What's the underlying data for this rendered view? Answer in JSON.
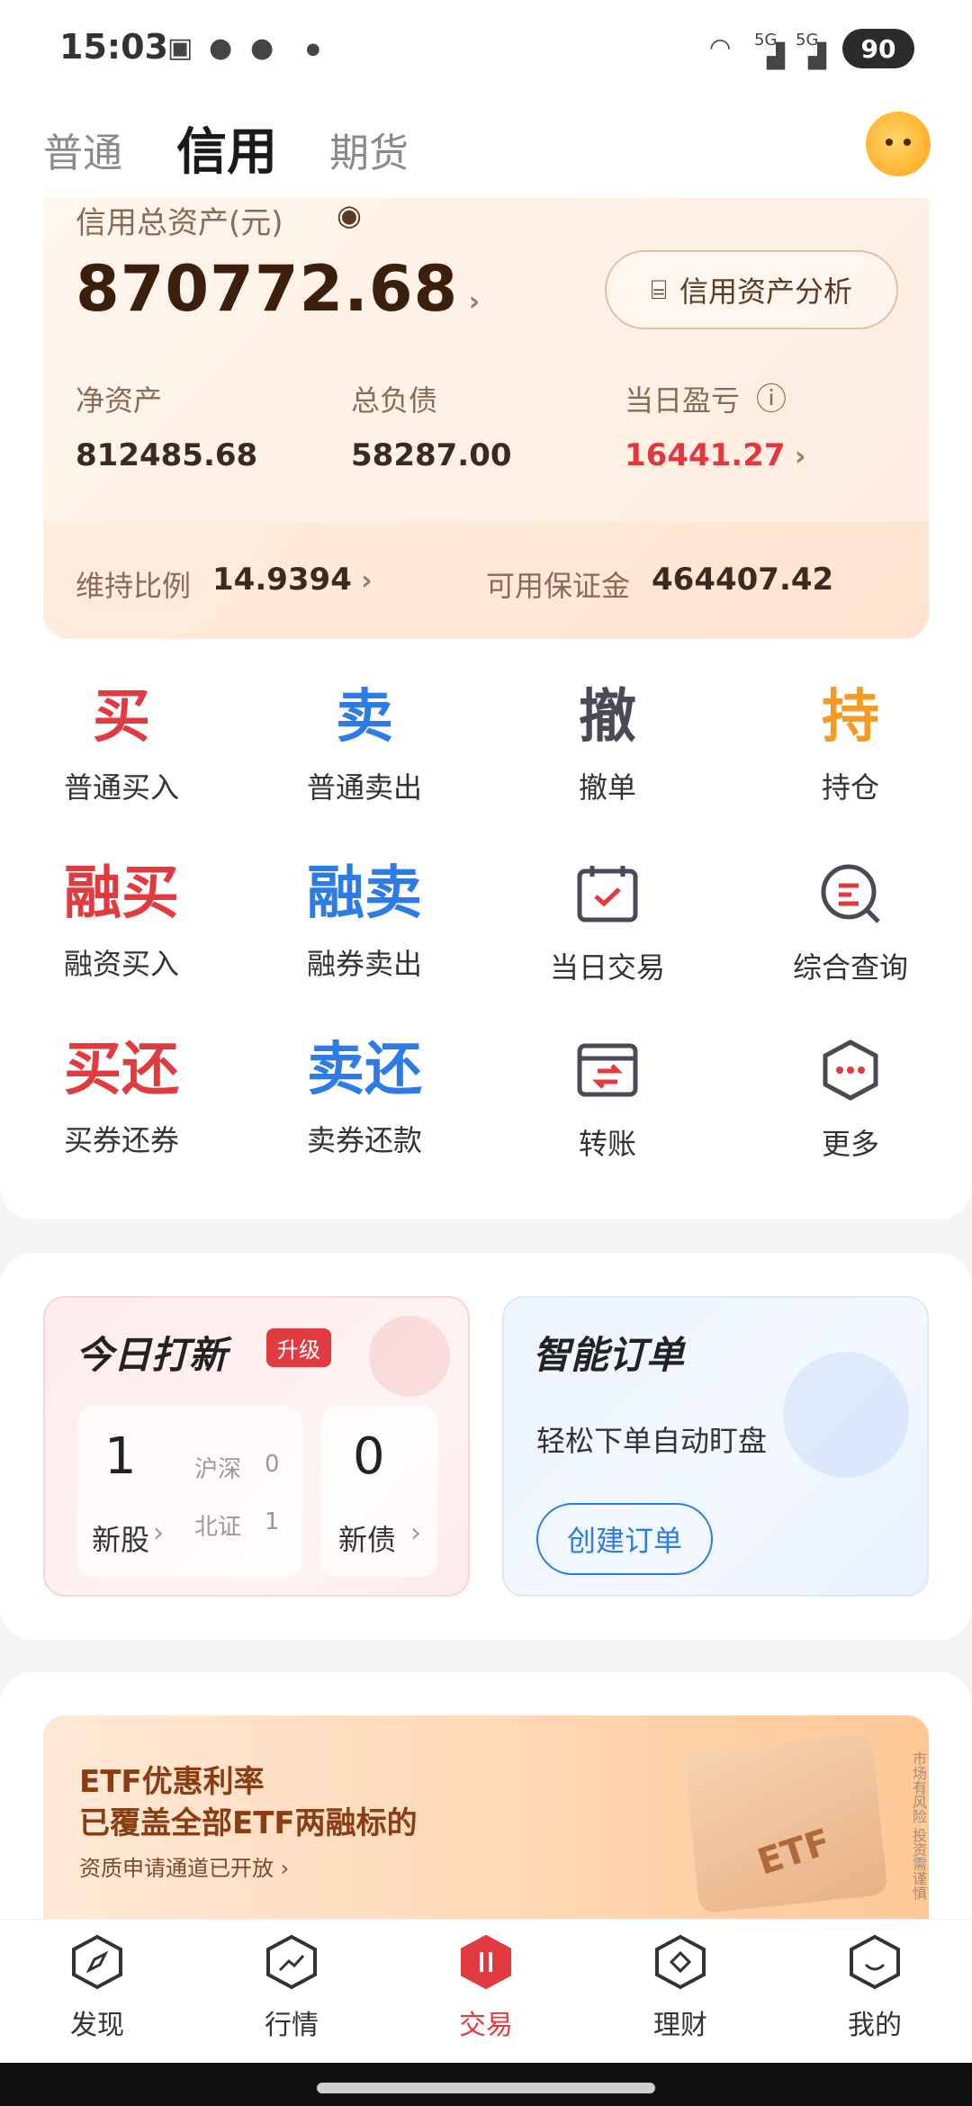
{
  "status_bar": {
    "time": "15:03",
    "signal1": "5G",
    "signal2": "5G",
    "battery": "90"
  },
  "tabs": [
    {
      "label": "普通",
      "active": false
    },
    {
      "label": "信用",
      "active": true
    },
    {
      "label": "期货",
      "active": false
    }
  ],
  "assets": {
    "total_label": "信用总资产(元)",
    "total_value": "870772.68",
    "analysis_button": "信用资产分析",
    "net_label": "净资产",
    "net_value": "812485.68",
    "debt_label": "总负债",
    "debt_value": "58287.00",
    "pnl_label": "当日盈亏",
    "pnl_value": "16441.27",
    "ratio_label": "维持比例",
    "ratio_value": "14.9394",
    "margin_label": "可用保证金",
    "margin_value": "464407.42"
  },
  "actions": [
    {
      "glyph": "买",
      "label": "普通买入",
      "color": "#e23b3f"
    },
    {
      "glyph": "卖",
      "label": "普通卖出",
      "color": "#2d7be6"
    },
    {
      "glyph": "撤",
      "label": "撤单",
      "color": "#4a4a56"
    },
    {
      "glyph": "持",
      "label": "持仓",
      "color": "#f59a23"
    },
    {
      "glyph": "融买",
      "label": "融资买入",
      "color": "#e23b3f"
    },
    {
      "glyph": "融卖",
      "label": "融券卖出",
      "color": "#2d7be6"
    },
    {
      "glyph": "",
      "label": "当日交易",
      "icon": "calendar-check-icon"
    },
    {
      "glyph": "",
      "label": "综合查询",
      "icon": "search-query-icon"
    },
    {
      "glyph": "买还",
      "label": "买券还券",
      "color": "#e23b3f"
    },
    {
      "glyph": "卖还",
      "label": "卖券还款",
      "color": "#2d7be6"
    },
    {
      "glyph": "",
      "label": "转账",
      "icon": "transfer-icon"
    },
    {
      "glyph": "",
      "label": "更多",
      "icon": "more-hexagon-icon"
    }
  ],
  "ipo": {
    "title": "今日打新",
    "badge": "升级",
    "stock_count": "1",
    "stock_label": "新股",
    "sh_sz_label": "沪深",
    "sh_sz_count": "0",
    "bj_label": "北证",
    "bj_count": "1",
    "bond_count": "0",
    "bond_label": "新债"
  },
  "smart_order": {
    "title": "智能订单",
    "desc": "轻松下单自动盯盘",
    "button": "创建订单"
  },
  "banner": {
    "line1": "ETF优惠利率",
    "line2": "已覆盖全部ETF两融标的",
    "line3": "资质申请通道已开放",
    "box_text": "ETF",
    "risk_note": "市场有风险 投资需谨慎"
  },
  "nav": [
    {
      "label": "发现",
      "icon": "compass-icon",
      "active": false
    },
    {
      "label": "行情",
      "icon": "trend-icon",
      "active": false
    },
    {
      "label": "交易",
      "icon": "trade-icon",
      "active": true
    },
    {
      "label": "理财",
      "icon": "finance-icon",
      "active": false
    },
    {
      "label": "我的",
      "icon": "profile-icon",
      "active": false
    }
  ],
  "colors": {
    "accent_red": "#e23b3f",
    "accent_blue": "#2d7be6",
    "accent_orange": "#f59a23"
  }
}
